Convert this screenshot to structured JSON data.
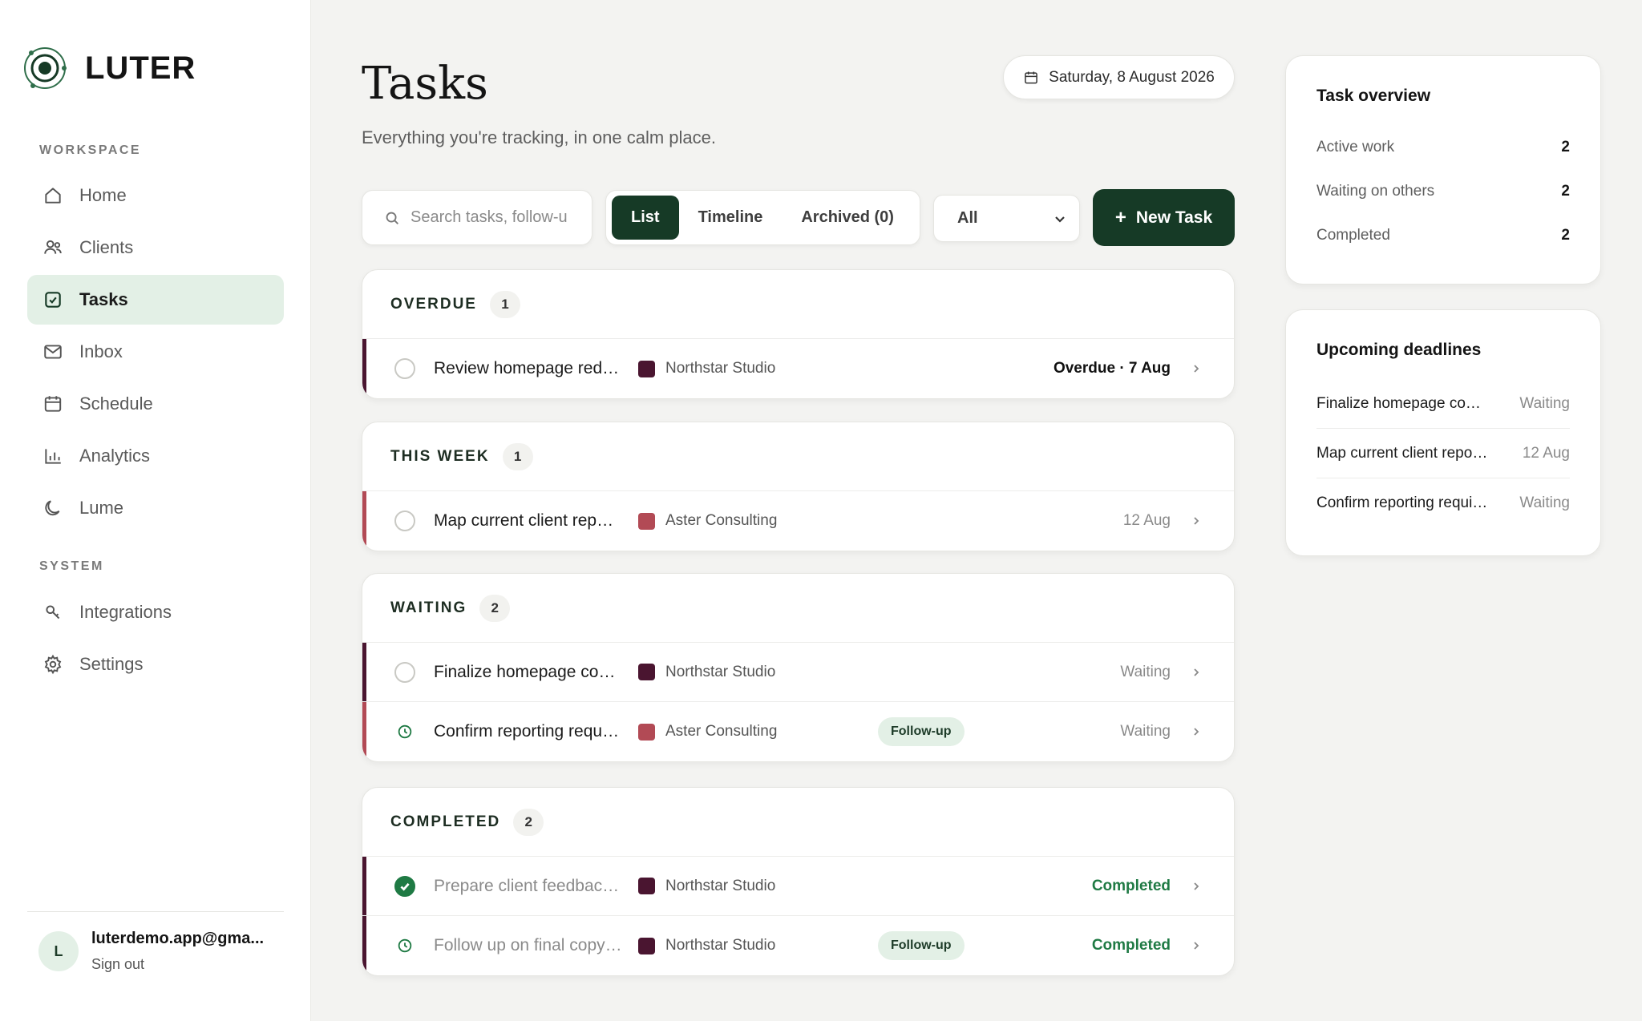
{
  "brand": {
    "name": "LUTER",
    "accent": "#163a26",
    "accent_light": "#e3f0e6"
  },
  "sidebar": {
    "workspace_label": "WORKSPACE",
    "system_label": "SYSTEM",
    "workspace_items": [
      {
        "label": "Home",
        "icon": "home-icon"
      },
      {
        "label": "Clients",
        "icon": "users-icon"
      },
      {
        "label": "Tasks",
        "icon": "checkbox-icon",
        "active": true
      },
      {
        "label": "Inbox",
        "icon": "mail-icon"
      },
      {
        "label": "Schedule",
        "icon": "calendar-icon"
      },
      {
        "label": "Analytics",
        "icon": "bar-chart-icon"
      },
      {
        "label": "Lume",
        "icon": "moon-icon"
      }
    ],
    "system_items": [
      {
        "label": "Integrations",
        "icon": "key-icon"
      },
      {
        "label": "Settings",
        "icon": "gear-icon"
      }
    ],
    "user": {
      "initial": "L",
      "email": "luterdemo.app@gma...",
      "sign_out": "Sign out"
    }
  },
  "header": {
    "title": "Tasks",
    "subtitle": "Everything you're tracking, in one calm place.",
    "date": "Saturday, 8 August 2026"
  },
  "toolbar": {
    "search_placeholder": "Search tasks, follow-u",
    "views": [
      "List",
      "Timeline",
      "Archived (0)"
    ],
    "active_view": "List",
    "filter_value": "All",
    "new_task_label": "New Task",
    "new_task_plus": "+"
  },
  "groups": [
    {
      "title": "OVERDUE",
      "count": "1",
      "tasks": [
        {
          "title": "Review homepage red…",
          "client": "Northstar Studio",
          "client_color": "#4a1530",
          "due": "Overdue · 7 Aug",
          "due_style": "overdue",
          "status": "open"
        }
      ]
    },
    {
      "title": "THIS WEEK",
      "count": "1",
      "tasks": [
        {
          "title": "Map current client rep…",
          "client": "Aster Consulting",
          "client_color": "#b24a55",
          "due": "12 Aug",
          "due_style": "normal",
          "status": "open"
        }
      ]
    },
    {
      "title": "WAITING",
      "count": "2",
      "tasks": [
        {
          "title": "Finalize homepage co…",
          "client": "Northstar Studio",
          "client_color": "#4a1530",
          "due": "Waiting",
          "due_style": "normal",
          "status": "open"
        },
        {
          "title": "Confirm reporting requ…",
          "client": "Aster Consulting",
          "client_color": "#b24a55",
          "tag": "Follow-up",
          "due": "Waiting",
          "due_style": "normal",
          "status": "clock"
        }
      ]
    },
    {
      "title": "COMPLETED",
      "count": "2",
      "tasks": [
        {
          "title": "Prepare client feedbac…",
          "client": "Northstar Studio",
          "client_color": "#4a1530",
          "due": "Completed",
          "due_style": "completed",
          "status": "done"
        },
        {
          "title": "Follow up on final copy…",
          "client": "Northstar Studio",
          "client_color": "#4a1530",
          "tag": "Follow-up",
          "due": "Completed",
          "due_style": "completed",
          "status": "clock"
        }
      ]
    }
  ],
  "overview": {
    "title": "Task overview",
    "rows": [
      {
        "label": "Active work",
        "value": "2"
      },
      {
        "label": "Waiting on others",
        "value": "2"
      },
      {
        "label": "Completed",
        "value": "2"
      }
    ]
  },
  "deadlines": {
    "title": "Upcoming deadlines",
    "rows": [
      {
        "title": "Finalize homepage co…",
        "due": "Waiting"
      },
      {
        "title": "Map current client repo…",
        "due": "12 Aug"
      },
      {
        "title": "Confirm reporting requi…",
        "due": "Waiting"
      }
    ]
  }
}
